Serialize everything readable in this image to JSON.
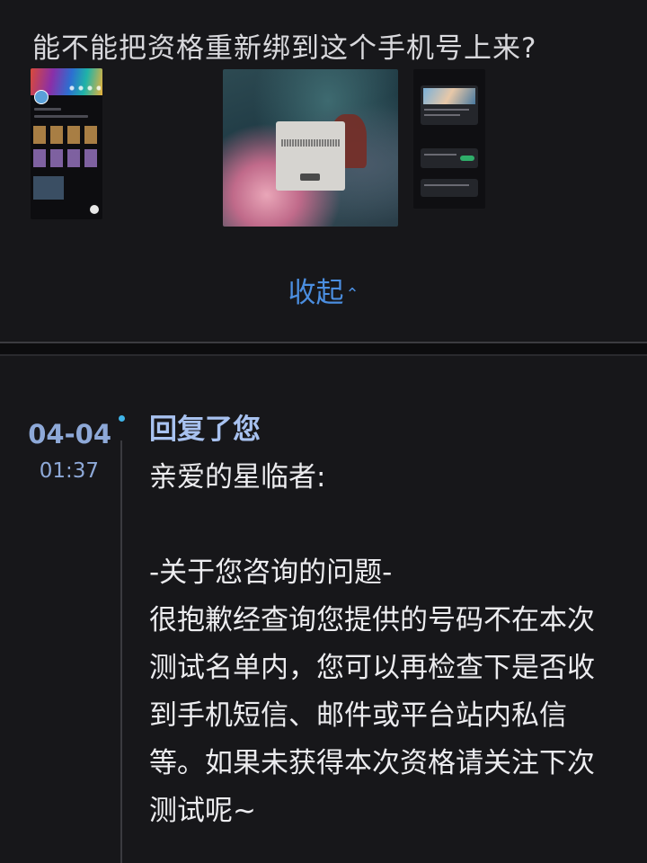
{
  "question": {
    "text": "能不能把资格重新绑到这个手机号上来?"
  },
  "attachments": [
    {
      "icon": "profile-screenshot-thumbnail"
    },
    {
      "icon": "game-dialog-screenshot-thumbnail"
    },
    {
      "icon": "chat-screenshot-thumbnail"
    }
  ],
  "collapse": {
    "label": "收起",
    "icon": "chevron-up-icon"
  },
  "reply": {
    "date": "04-04",
    "time": "01:37",
    "title": "回复了您",
    "greeting": "亲爱的星临者:",
    "section": "-关于您咨询的问题-",
    "body": "很抱歉经查询您提供的号码不在本次测试名单内，您可以再检查下是否收到手机短信、邮件或平台站内私信等。如果未获得本次资格请关注下次测试呢~"
  },
  "colors": {
    "background": "#17171a",
    "accent_link": "#4b8ee0",
    "date_color": "#8ea9d8",
    "title_color": "#a8c2f0",
    "timeline_dot": "#3fb4e8"
  }
}
